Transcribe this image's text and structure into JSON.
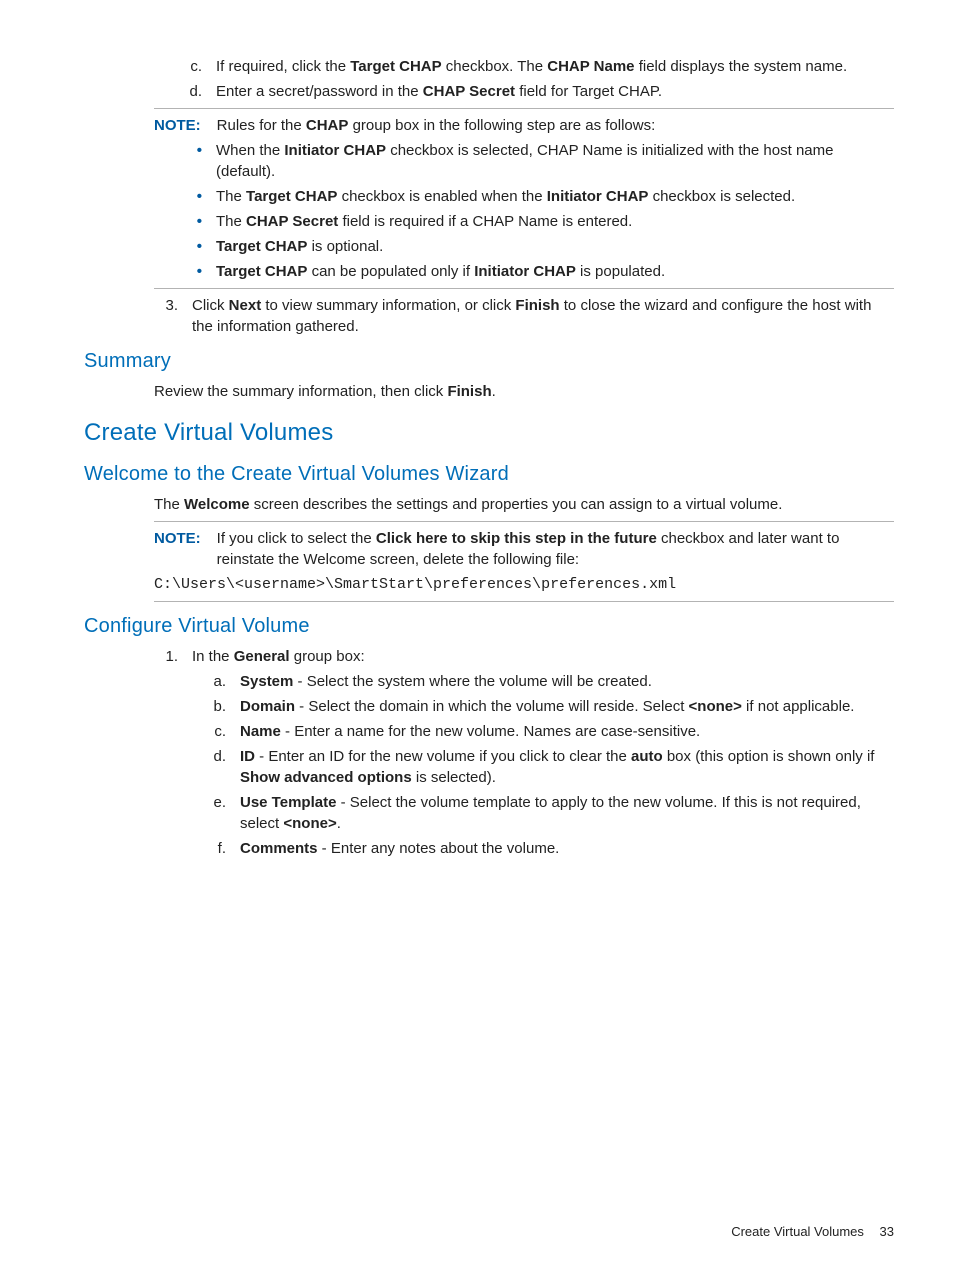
{
  "steps_cd": {
    "c": [
      "If required, click the ",
      "Target CHAP",
      " checkbox. The ",
      "CHAP Name",
      " field displays the system name."
    ],
    "d": [
      "Enter a secret/password in the ",
      "CHAP Secret",
      " field for Target CHAP."
    ]
  },
  "note1": {
    "label": "NOTE:",
    "lead": [
      "Rules for the ",
      "CHAP",
      " group box in the following step are as follows:"
    ],
    "bullets": [
      [
        "When the ",
        "Initiator CHAP",
        " checkbox is selected, CHAP Name is initialized with the host name (default)."
      ],
      [
        "The ",
        "Target CHAP",
        " checkbox is enabled when the ",
        "Initiator CHAP",
        " checkbox is selected."
      ],
      [
        "The ",
        "CHAP Secret",
        " field is required if a CHAP Name is entered."
      ],
      [
        "",
        "Target CHAP",
        " is optional."
      ],
      [
        "",
        "Target CHAP",
        " can be populated only if ",
        "Initiator CHAP",
        " is populated."
      ]
    ]
  },
  "step3": [
    "Click ",
    "Next",
    " to view summary information, or click ",
    "Finish",
    " to close the wizard and configure the host with the information gathered."
  ],
  "summary": {
    "heading": "Summary",
    "text": [
      "Review the summary information, then click ",
      "Finish",
      "."
    ]
  },
  "cvv": {
    "heading": "Create Virtual Volumes"
  },
  "welcome": {
    "heading": "Welcome to the Create Virtual Volumes Wizard",
    "text": [
      "The ",
      "Welcome",
      " screen describes the settings and properties you can assign to a virtual volume."
    ]
  },
  "note2": {
    "label": "NOTE:",
    "text": [
      "If you click to select the ",
      "Click here to skip this step in the future",
      " checkbox and later want to reinstate the Welcome screen, delete the following file:"
    ],
    "path": "C:\\Users\\<username>\\SmartStart\\preferences\\preferences.xml"
  },
  "configure": {
    "heading": "Configure Virtual Volume",
    "step1_lead": [
      "In the ",
      "General",
      " group box:"
    ],
    "subs": {
      "a": [
        "",
        "System",
        " - Select the system where the volume will be created."
      ],
      "b": [
        "",
        "Domain",
        " - Select the domain in which the volume will reside. Select ",
        "<none>",
        " if not applicable."
      ],
      "c": [
        "",
        "Name",
        " - Enter a name for the new volume. Names are case-sensitive."
      ],
      "d": [
        "",
        "ID",
        " - Enter an ID for the new volume if you click to clear the ",
        "auto",
        " box (this option is shown only if ",
        "Show advanced options",
        " is selected)."
      ],
      "e": [
        "",
        "Use Template",
        " - Select the volume template to apply to the new volume. If this is not required, select ",
        "<none>",
        "."
      ],
      "f": [
        "",
        "Comments",
        " - Enter any notes about the volume."
      ]
    }
  },
  "markers": {
    "c": "c.",
    "d": "d.",
    "three": "3.",
    "one": "1.",
    "a": "a.",
    "b": "b.",
    "cc": "c.",
    "dd": "d.",
    "e": "e.",
    "f": "f.",
    "bullet": "•"
  },
  "footer": {
    "title": "Create Virtual Volumes",
    "page": "33"
  }
}
